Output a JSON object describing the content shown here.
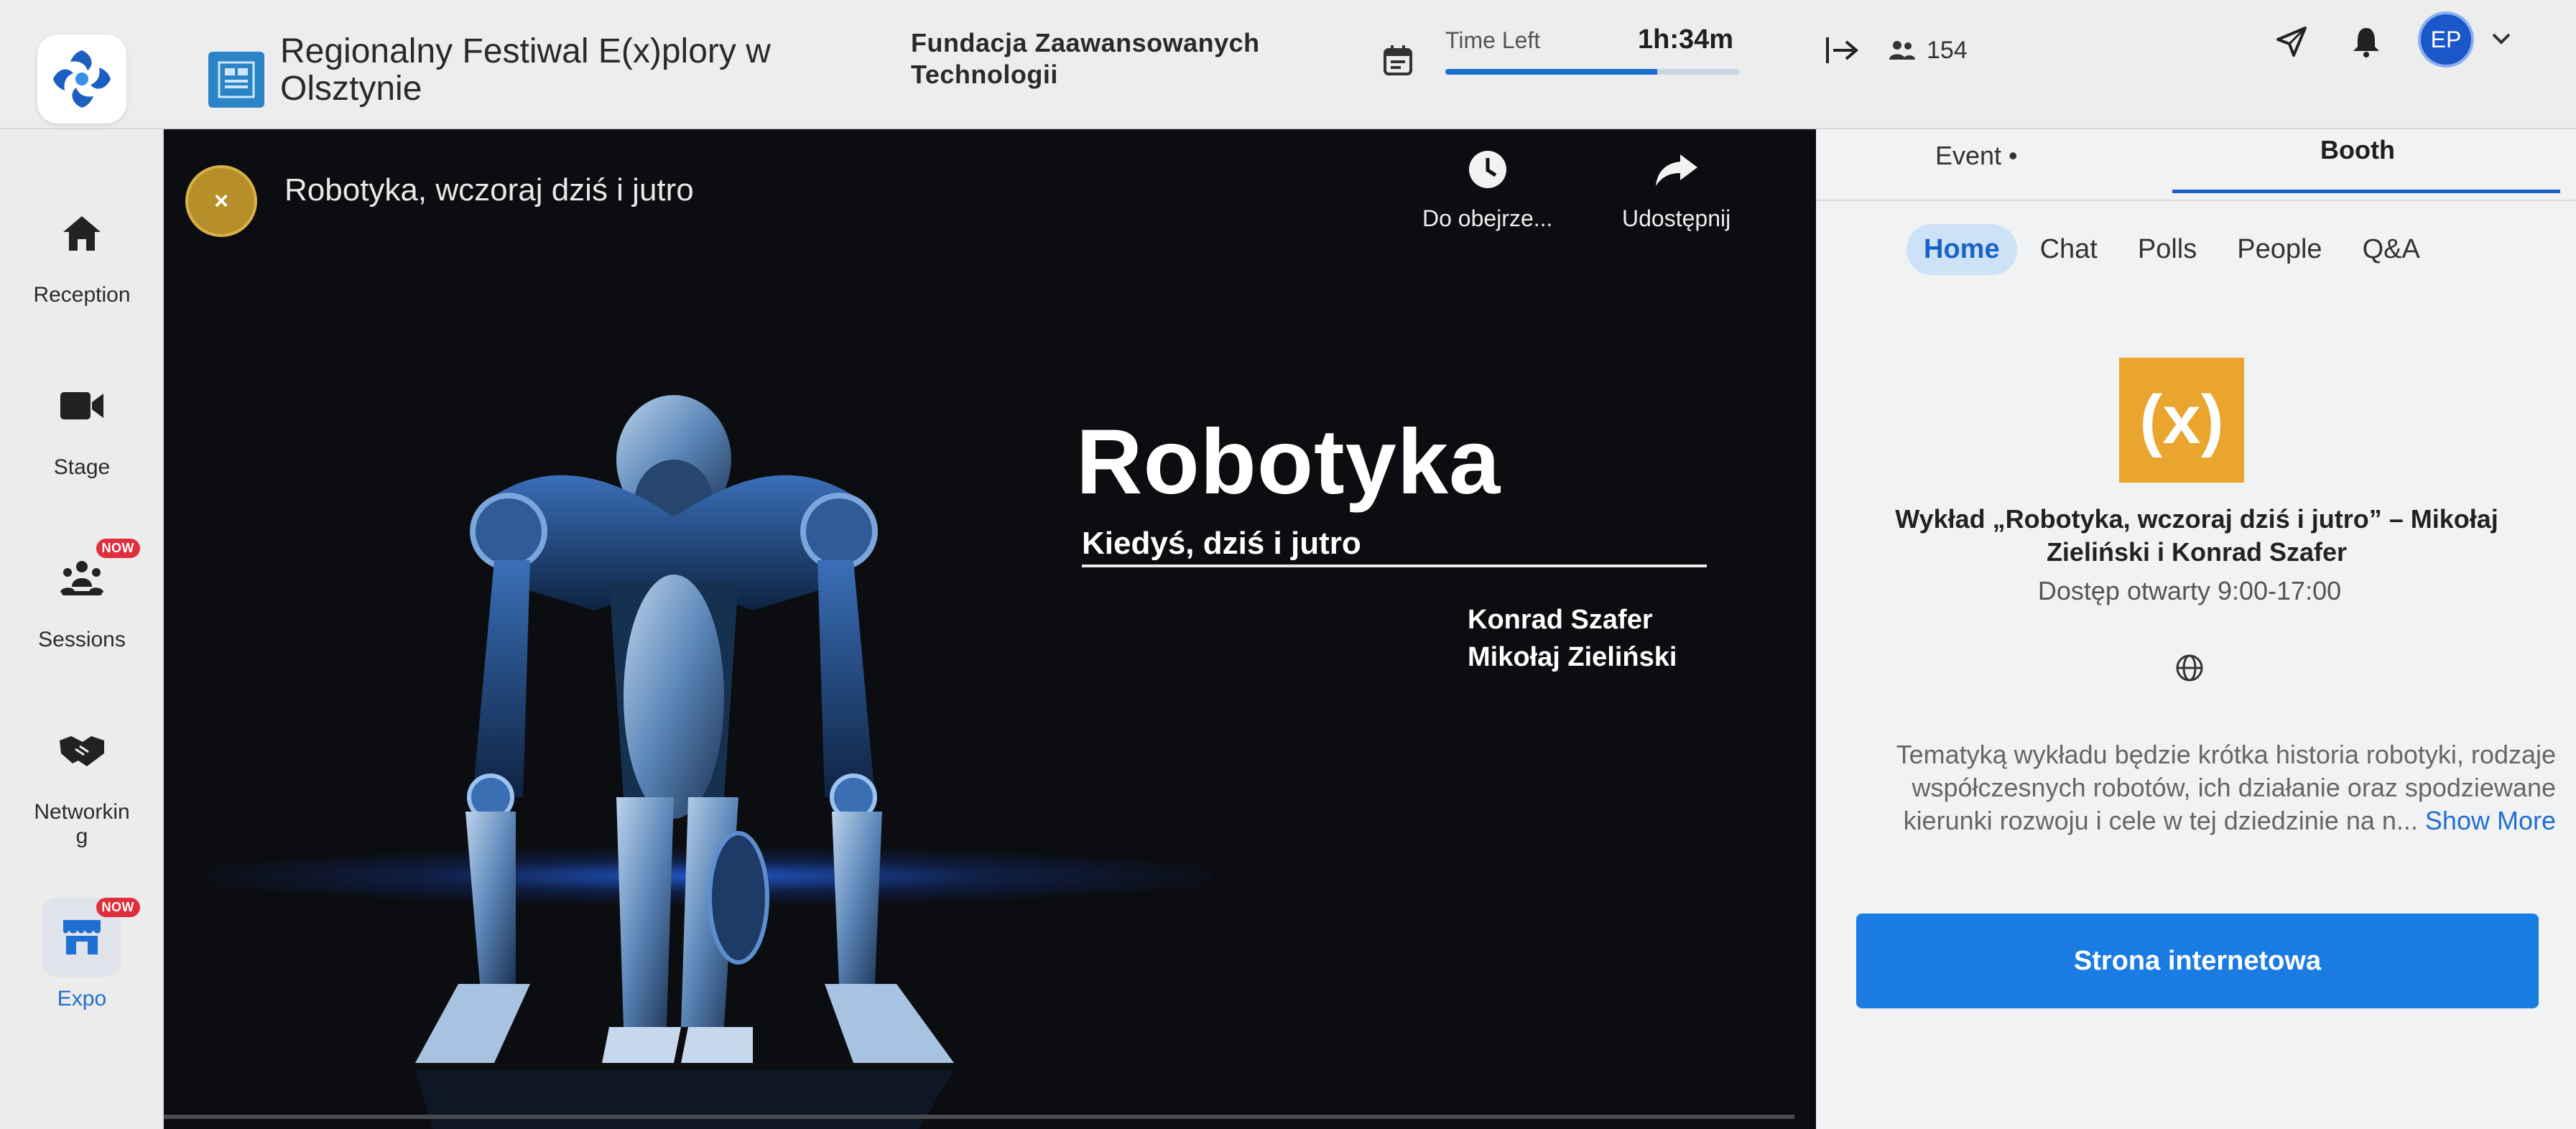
{
  "header": {
    "event_title": "Regionalny Festiwal E(x)plory w Olsztynie",
    "organizer": "Fundacja Zaawansowanych Technologii",
    "time_left_label": "Time Left",
    "time_left_value": "1h:34m",
    "time_left_progress_fraction": 0.72,
    "attendee_count": "154",
    "avatar_initials": "EP"
  },
  "sidebar": {
    "items": [
      {
        "label": "Reception",
        "icon": "home-icon",
        "badge": ""
      },
      {
        "label": "Stage",
        "icon": "video-camera-icon",
        "badge": ""
      },
      {
        "label": "Sessions",
        "icon": "sessions-icon",
        "badge": "NOW"
      },
      {
        "label": "Networkin g",
        "icon": "handshake-icon",
        "badge": ""
      },
      {
        "label": "Expo",
        "icon": "booth-icon",
        "badge": "NOW"
      }
    ]
  },
  "video": {
    "badge_text": "×",
    "session_title": "Robotyka, wczoraj dziś i jutro",
    "watch_later_label": "Do obejrze...",
    "share_label": "Udostępnij",
    "slide_heading": "Robotyka",
    "slide_subtitle": "Kiedyś, dziś i jutro",
    "slide_authors": [
      "Konrad Szafer",
      "Mikołaj Zieliński"
    ]
  },
  "panel": {
    "tabs": [
      "Event •",
      "Booth"
    ],
    "active_tab": "Booth",
    "subtabs": [
      "Home",
      "Chat",
      "Polls",
      "People",
      "Q&A"
    ],
    "active_subtab": "Home",
    "booth_logo_text": "(x)",
    "booth_title": "Wykład „Robotyka, wczoraj dziś i jutro” – Mikołaj Zieliński i Konrad Szafer",
    "booth_hours": "Dostęp otwarty 9:00-17:00",
    "description": "Tematyką wykładu będzie krótka historia robotyki, rodzaje współczesnych robotów, ich działanie oraz spodziewane kierunki rozwoju i cele w tej dziedzinie na n...",
    "show_more_label": "Show More",
    "website_button_label": "Strona internetowa"
  },
  "colors": {
    "accent": "#1a7ce2",
    "active_tab_underline": "#1f5fc4",
    "now_badge": "#e02e3d",
    "booth_logo_bg": "#e9a52d",
    "video_bg": "#0c0d10"
  }
}
